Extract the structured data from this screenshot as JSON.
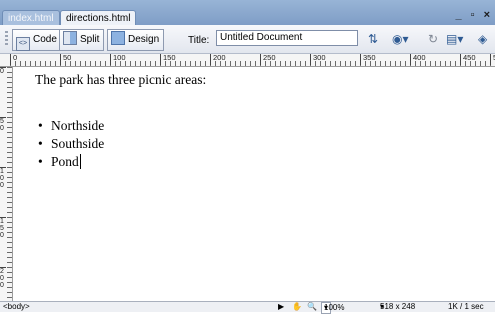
{
  "tabs": [
    {
      "label": "index.html",
      "active": false
    },
    {
      "label": "directions.html",
      "active": true
    }
  ],
  "window_controls": "_ ▫ ×",
  "toolbar": {
    "code_label": "Code",
    "split_label": "Split",
    "design_label": "Design",
    "title_label": "Title:",
    "title_value": "Untitled Document",
    "icons": [
      "file-management-icon",
      "preview-browser-icon",
      "refresh-icon",
      "view-options-icon",
      "visual-aids-icon"
    ]
  },
  "ruler": {
    "top_labels": [
      "0",
      "50",
      "100",
      "150",
      "200",
      "250",
      "300",
      "350",
      "400",
      "450",
      "5"
    ],
    "left_labels": [
      "0",
      "50",
      "100",
      "150",
      "200"
    ]
  },
  "document": {
    "paragraph": "The park has three picnic areas:",
    "list": [
      "Northside",
      "Southside",
      "Pond"
    ]
  },
  "status": {
    "tag": "<body>",
    "zoom": "100%",
    "dimensions": "518 x 248",
    "size": "1K / 1 sec"
  },
  "colors": {
    "tab_bar": "#8aa7cd",
    "toolbar": "#eceff5"
  }
}
